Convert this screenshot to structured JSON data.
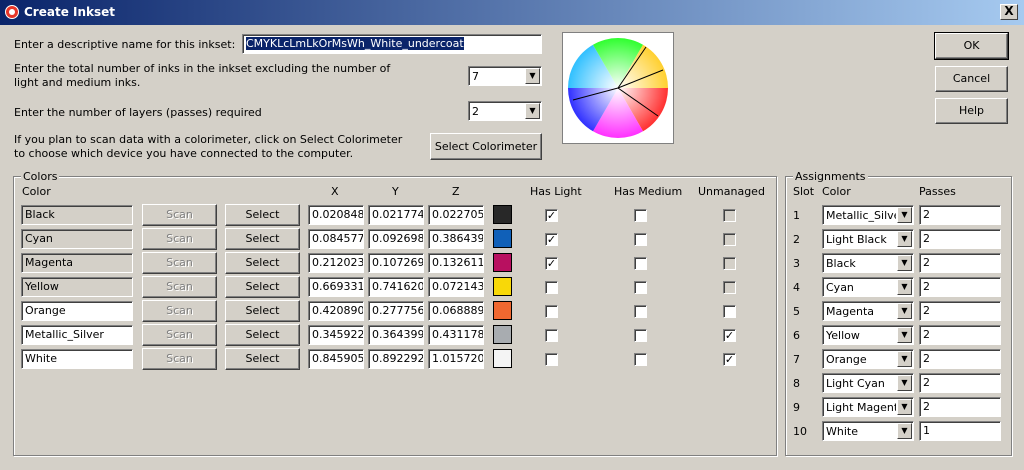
{
  "window": {
    "title": "Create Inkset",
    "close_label": "X"
  },
  "form": {
    "name_label": "Enter a descriptive name for this inkset:",
    "name_value": "CMYKLcLmLkOrMsWh_White_undercoat",
    "inks_label": "Enter the total number of inks in the inkset excluding the number of light and medium inks.",
    "inks_value": "7",
    "layers_label": "Enter the number of layers (passes) required",
    "layers_value": "2",
    "colorimeter_label": "If you plan to scan data with a colorimeter, click on Select Colorimeter to choose which device you have connected to the computer.",
    "select_colorimeter_label": "Select Colorimeter"
  },
  "buttons": {
    "ok": "OK",
    "cancel": "Cancel",
    "help": "Help"
  },
  "colors_group": {
    "title": "Colors",
    "headers": {
      "color": "Color",
      "x": "X",
      "y": "Y",
      "z": "Z",
      "has_light": "Has Light",
      "has_medium": "Has Medium",
      "unmanaged": "Unmanaged"
    },
    "scan_label": "Scan",
    "select_label": "Select",
    "rows": [
      {
        "name": "Black",
        "x": "0.020848",
        "y": "0.021774",
        "z": "0.022705",
        "swatch": "#282828",
        "has_light": true,
        "has_medium": false,
        "unmanaged": false,
        "editable": false
      },
      {
        "name": "Cyan",
        "x": "0.084577",
        "y": "0.092698",
        "z": "0.386439",
        "swatch": "#1060b8",
        "has_light": true,
        "has_medium": false,
        "unmanaged": false,
        "editable": false
      },
      {
        "name": "Magenta",
        "x": "0.212023",
        "y": "0.107269",
        "z": "0.132611",
        "swatch": "#b81060",
        "has_light": true,
        "has_medium": false,
        "unmanaged": false,
        "editable": false
      },
      {
        "name": "Yellow",
        "x": "0.669331",
        "y": "0.741620",
        "z": "0.072143",
        "swatch": "#f8d808",
        "has_light": false,
        "has_medium": false,
        "unmanaged": false,
        "editable": false
      },
      {
        "name": "Orange",
        "x": "0.420890",
        "y": "0.277756",
        "z": "0.068889",
        "swatch": "#f06830",
        "has_light": false,
        "has_medium": false,
        "unmanaged": false,
        "editable": true
      },
      {
        "name": "Metallic_Silver",
        "x": "0.345922",
        "y": "0.364399",
        "z": "0.431178",
        "swatch": "#a8acb0",
        "has_light": false,
        "has_medium": false,
        "unmanaged": true,
        "editable": true
      },
      {
        "name": "White",
        "x": "0.845905",
        "y": "0.892292",
        "z": "1.015720",
        "swatch": "#f4f4f4",
        "has_light": false,
        "has_medium": false,
        "unmanaged": true,
        "editable": true
      }
    ]
  },
  "assignments_group": {
    "title": "Assignments",
    "headers": {
      "slot": "Slot",
      "color": "Color",
      "passes": "Passes"
    },
    "rows": [
      {
        "slot": "1",
        "color": "Metallic_Silver",
        "passes": "2"
      },
      {
        "slot": "2",
        "color": "Light Black",
        "passes": "2"
      },
      {
        "slot": "3",
        "color": "Black",
        "passes": "2"
      },
      {
        "slot": "4",
        "color": "Cyan",
        "passes": "2"
      },
      {
        "slot": "5",
        "color": "Magenta",
        "passes": "2"
      },
      {
        "slot": "6",
        "color": "Yellow",
        "passes": "2"
      },
      {
        "slot": "7",
        "color": "Orange",
        "passes": "2"
      },
      {
        "slot": "8",
        "color": "Light Cyan",
        "passes": "2"
      },
      {
        "slot": "9",
        "color": "Light Magenta",
        "passes": "2"
      },
      {
        "slot": "10",
        "color": "White",
        "passes": "1"
      }
    ]
  }
}
